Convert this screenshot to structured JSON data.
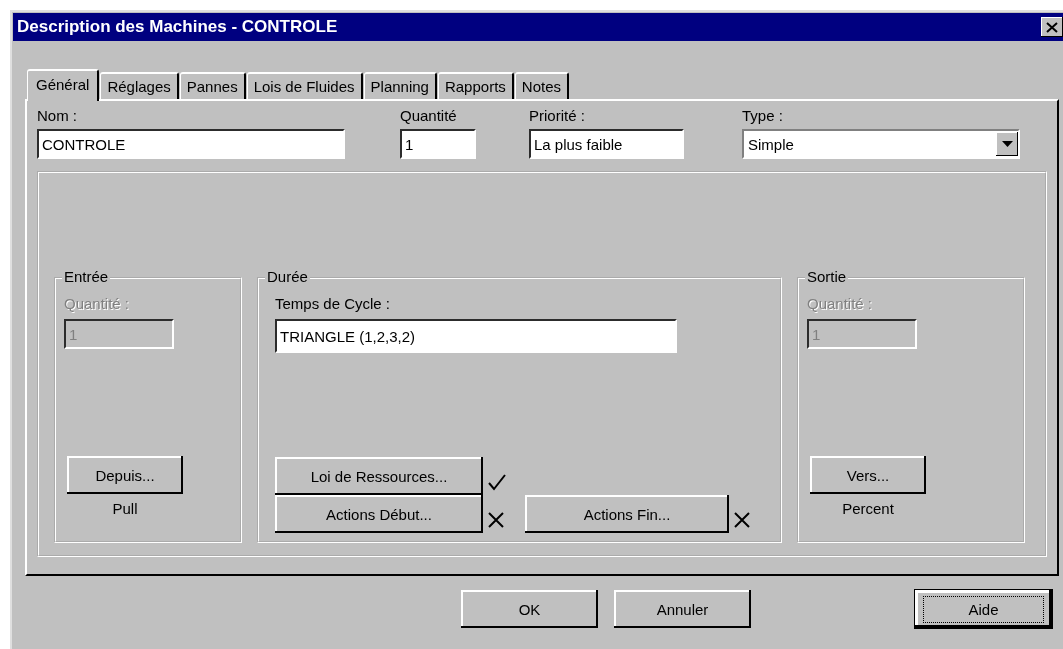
{
  "window": {
    "title": "Description des Machines - CONTROLE"
  },
  "tabs": [
    {
      "label": "Général",
      "selected": true
    },
    {
      "label": "Réglages",
      "selected": false
    },
    {
      "label": "Pannes",
      "selected": false
    },
    {
      "label": "Lois de Fluides",
      "selected": false
    },
    {
      "label": "Planning",
      "selected": false
    },
    {
      "label": "Rapports",
      "selected": false
    },
    {
      "label": "Notes",
      "selected": false
    }
  ],
  "fields": {
    "name": {
      "label": "Nom :",
      "value": "CONTROLE"
    },
    "quantity": {
      "label": "Quantité",
      "value": "1"
    },
    "priority": {
      "label": "Priorité :",
      "value": "La plus faible"
    },
    "type": {
      "label": "Type :",
      "value": "Simple"
    }
  },
  "entree": {
    "title": "Entrée",
    "quantity_label": "Quantité :",
    "quantity_value": "1",
    "disabled": true,
    "button": "Depuis...",
    "mode": "Pull"
  },
  "duree": {
    "title": "Durée",
    "cycle_label": "Temps de Cycle :",
    "cycle_value": "TRIANGLE (1,2,3,2)",
    "actions": [
      {
        "label": "Loi de Ressources...",
        "configured": true
      },
      {
        "label": "Actions Début...",
        "configured": false
      },
      {
        "label": "Actions Fin...",
        "configured": false
      }
    ]
  },
  "sortie": {
    "title": "Sortie",
    "quantity_label": "Quantité :",
    "quantity_value": "1",
    "disabled": true,
    "button": "Vers...",
    "mode": "Percent"
  },
  "buttons": [
    {
      "label": "OK",
      "default": false
    },
    {
      "label": "Annuler",
      "default": false
    },
    {
      "label": "Aide",
      "default": true
    }
  ]
}
